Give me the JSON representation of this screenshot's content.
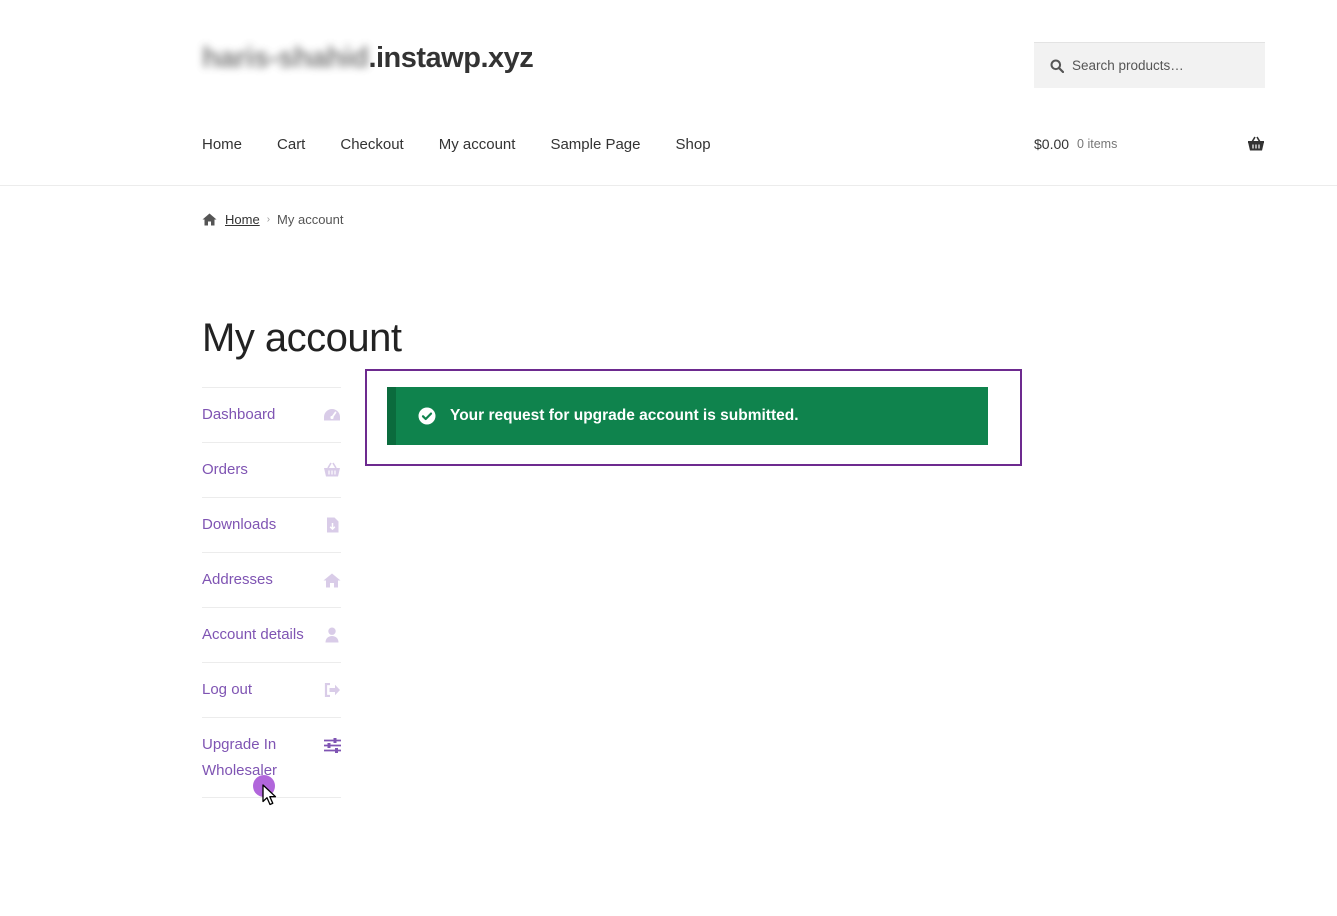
{
  "site": {
    "title_blurred": "haris-shahid",
    "title_suffix": ".instawp.xyz"
  },
  "search": {
    "placeholder": "Search products…"
  },
  "nav": {
    "items": [
      "Home",
      "Cart",
      "Checkout",
      "My account",
      "Sample Page",
      "Shop"
    ]
  },
  "cart": {
    "amount": "$0.00",
    "count": "0 items"
  },
  "breadcrumb": {
    "home": "Home",
    "separator": "›",
    "current": "My account"
  },
  "page": {
    "title": "My account"
  },
  "account_nav": {
    "items": [
      {
        "label": "Dashboard",
        "icon": "dashboard-icon"
      },
      {
        "label": "Orders",
        "icon": "basket-icon"
      },
      {
        "label": "Downloads",
        "icon": "file-download-icon"
      },
      {
        "label": "Addresses",
        "icon": "home-icon"
      },
      {
        "label": "Account details",
        "icon": "user-icon"
      },
      {
        "label": "Log out",
        "icon": "sign-out-icon"
      },
      {
        "label": "Upgrade In Wholesaler",
        "icon": "sliders-icon"
      }
    ]
  },
  "notice": {
    "message": "Your request for upgrade account is submitted.",
    "type": "success"
  },
  "colors": {
    "accent": "#7f54b3",
    "success": "#0f834d",
    "highlight_border": "#6d2a8f"
  }
}
